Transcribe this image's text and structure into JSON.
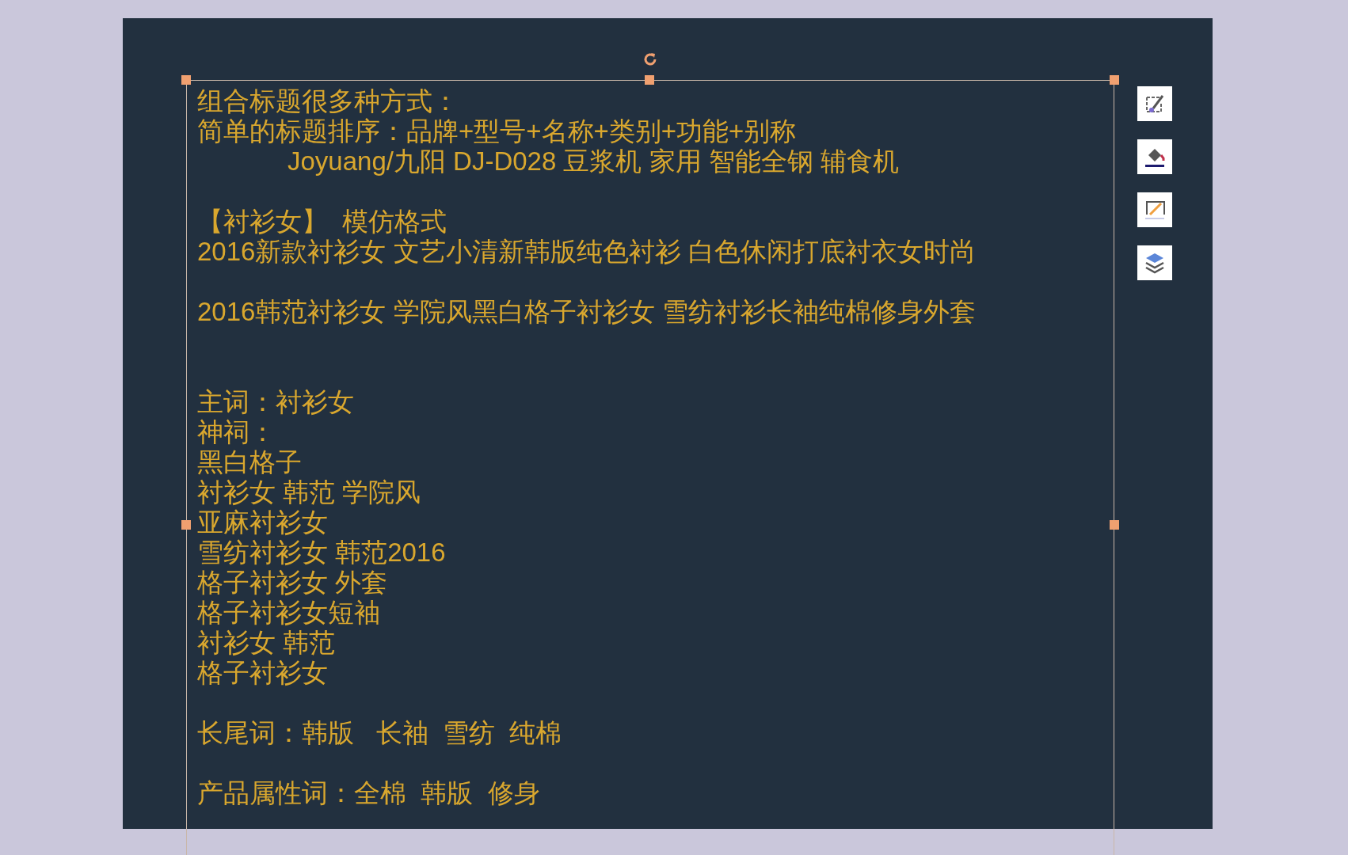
{
  "slide": {
    "text_box": {
      "selected": true,
      "blocks": [
        {
          "kind": "spaced",
          "lines": [
            {
              "kind": "plain",
              "text": "组合标题很多种方式："
            },
            {
              "kind": "plain",
              "text": "简单的标题排序：品牌+型号+名称+类别+功能+别称"
            },
            {
              "kind": "indented",
              "text": "Joyuang/九阳 DJ-D028 豆浆机 家用 智能全钢 辅食机"
            }
          ]
        },
        {
          "kind": "spaced",
          "lines": [
            {
              "kind": "plain",
              "text": "【衬衫女】  模仿格式"
            },
            {
              "kind": "plain",
              "text": "2016新款衬衫女 文艺小清新韩版纯色衬衫 白色休闲打底衬衣女时尚"
            }
          ]
        },
        {
          "kind": "wide",
          "lines": [
            {
              "kind": "plain",
              "text": "2016韩范衬衫女 学院风黑白格子衬衫女 雪纺衬衫长袖纯棉修身外套"
            }
          ]
        },
        {
          "kind": "spaced",
          "lines": [
            {
              "kind": "plain",
              "text": "主词：衬衫女"
            },
            {
              "kind": "plain",
              "text": "神祠："
            },
            {
              "kind": "plain",
              "text": "黑白格子"
            },
            {
              "kind": "plain",
              "text": "衬衫女 韩范 学院风"
            },
            {
              "kind": "plain",
              "text": "亚麻衬衫女"
            },
            {
              "kind": "plain",
              "text": "雪纺衬衫女 韩范2016"
            },
            {
              "kind": "plain",
              "text": "格子衬衫女 外套"
            },
            {
              "kind": "plain",
              "text": "格子衬衫女短袖"
            },
            {
              "kind": "plain",
              "text": "衬衫女 韩范"
            },
            {
              "kind": "plain",
              "text": "格子衬衫女"
            }
          ]
        },
        {
          "kind": "spaced",
          "lines": [
            {
              "kind": "plain",
              "text": "长尾词：韩版   长袖  雪纺  纯棉"
            }
          ]
        },
        {
          "kind": "last",
          "lines": [
            {
              "kind": "plain",
              "text": "产品属性词：全棉  韩版  修身"
            }
          ]
        }
      ]
    }
  }
}
